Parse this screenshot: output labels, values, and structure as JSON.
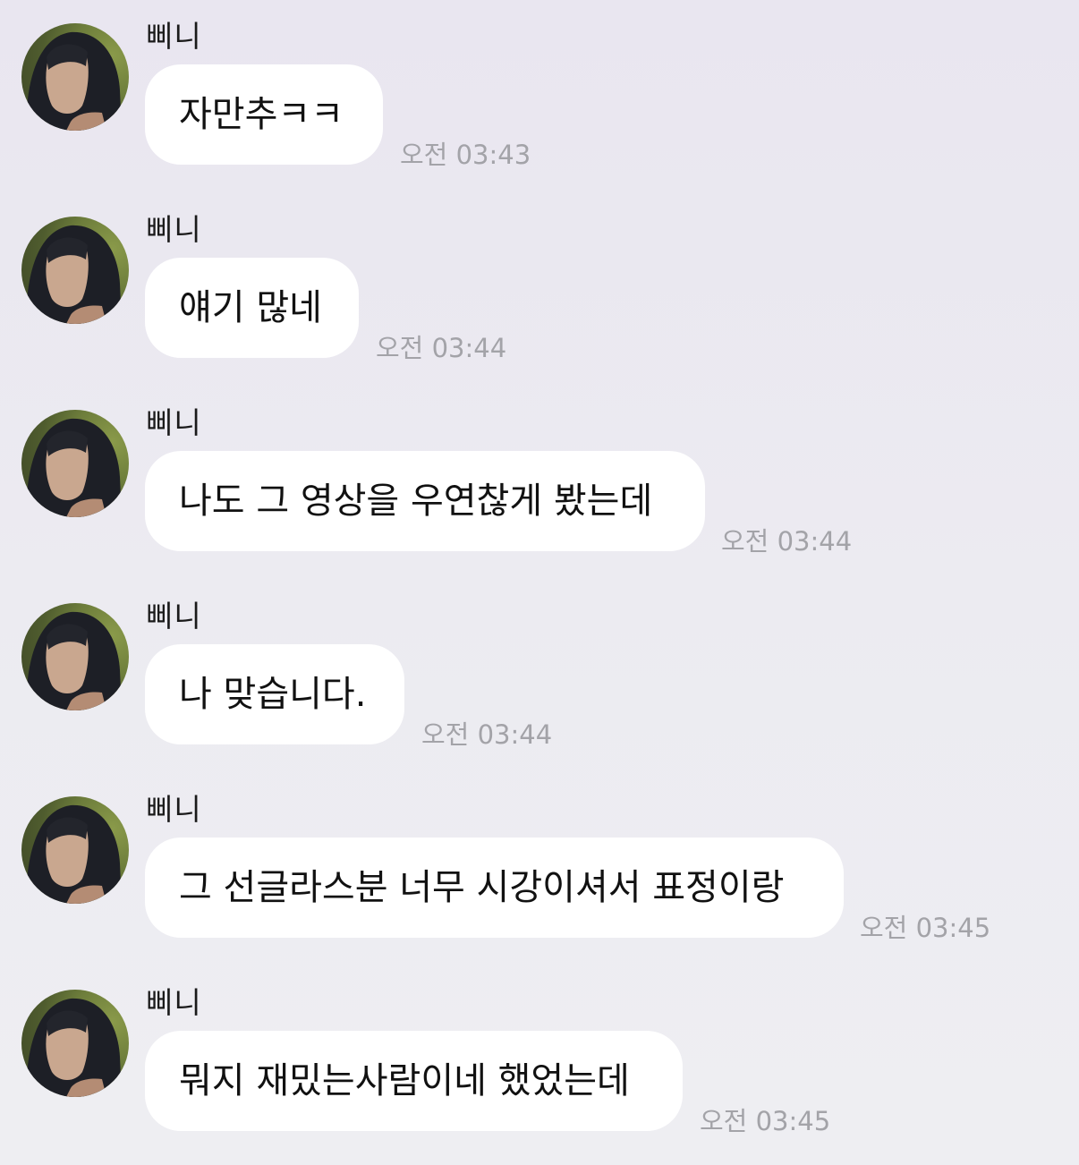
{
  "messages": [
    {
      "sender": "삐니",
      "text": "자만추ㅋㅋ",
      "time": "오전 03:43"
    },
    {
      "sender": "삐니",
      "text": "얘기 많네",
      "time": "오전 03:44"
    },
    {
      "sender": "삐니",
      "text": "나도 그 영상을 우연찮게 봤는데",
      "time": "오전 03:44"
    },
    {
      "sender": "삐니",
      "text": "나 맞습니다.",
      "time": "오전 03:44"
    },
    {
      "sender": "삐니",
      "text": "그 선글라스분 너무 시강이셔서 표정이랑",
      "time": "오전 03:45"
    },
    {
      "sender": "삐니",
      "text": "뭐지 재밌는사람이네 했었는데",
      "time": "오전 03:45"
    }
  ]
}
